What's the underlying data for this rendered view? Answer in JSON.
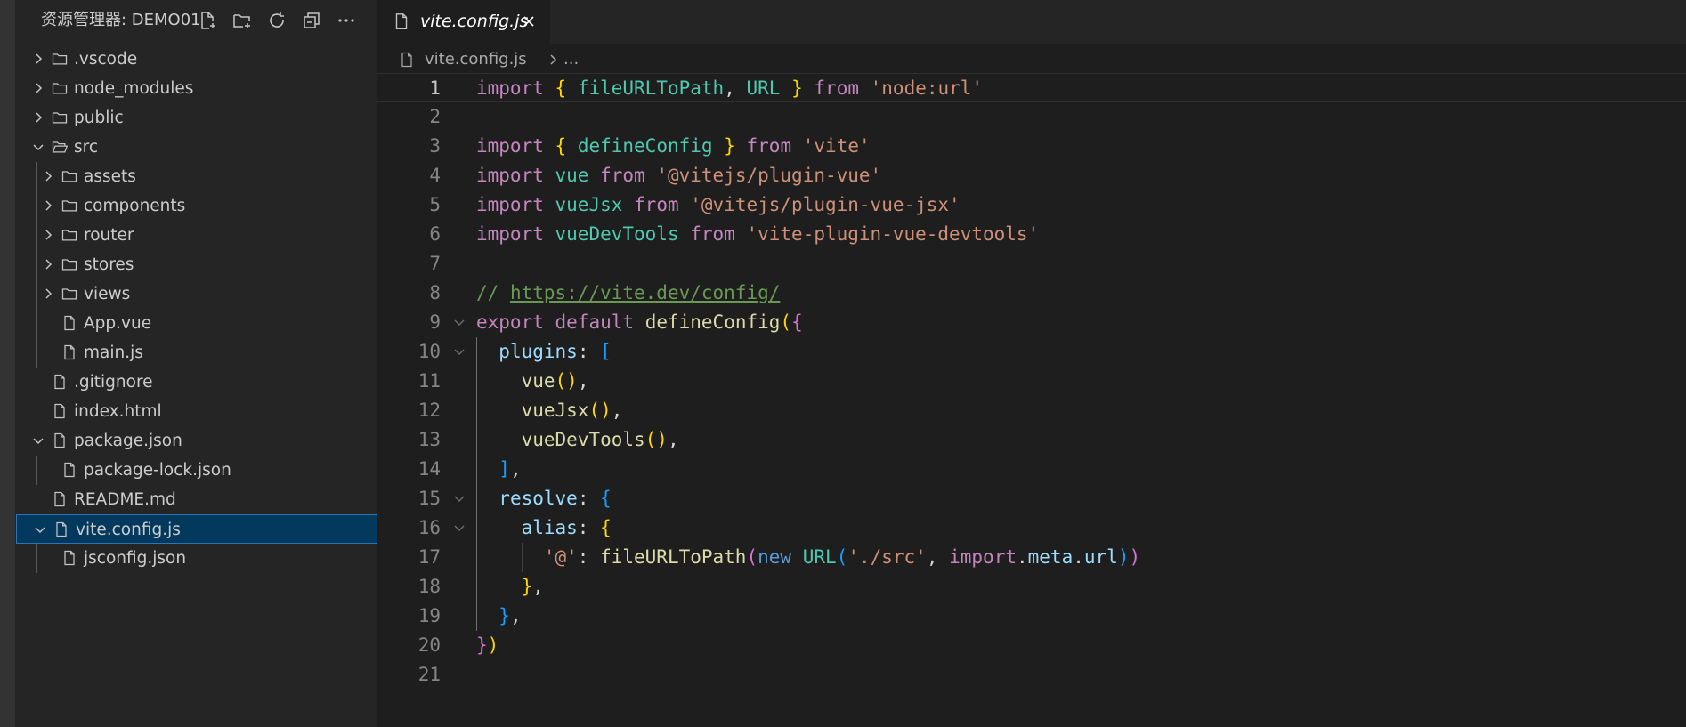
{
  "colors": {
    "sidebar_bg": "#252526",
    "editor_bg": "#1e1e1e",
    "selection_bg": "#04395e",
    "selection_border": "#2c74b8",
    "keyword": "#c586c0",
    "string": "#ce9178",
    "function": "#dcdcaa",
    "comment": "#6a9955"
  },
  "explorer": {
    "title": "资源管理器: DEMO01",
    "actions": [
      {
        "name": "new-file-icon"
      },
      {
        "name": "new-folder-icon"
      },
      {
        "name": "refresh-icon"
      },
      {
        "name": "collapse-all-icon"
      },
      {
        "name": "more-actions-icon"
      }
    ],
    "items": [
      {
        "label": ".vscode",
        "depth": 0,
        "type": "folder",
        "expanded": false,
        "selected": false
      },
      {
        "label": "node_modules",
        "depth": 0,
        "type": "folder",
        "expanded": false,
        "selected": false
      },
      {
        "label": "public",
        "depth": 0,
        "type": "folder",
        "expanded": false,
        "selected": false
      },
      {
        "label": "src",
        "depth": 0,
        "type": "folder",
        "expanded": true,
        "selected": false
      },
      {
        "label": "assets",
        "depth": 1,
        "type": "folder",
        "expanded": false,
        "selected": false
      },
      {
        "label": "components",
        "depth": 1,
        "type": "folder",
        "expanded": false,
        "selected": false
      },
      {
        "label": "router",
        "depth": 1,
        "type": "folder",
        "expanded": false,
        "selected": false
      },
      {
        "label": "stores",
        "depth": 1,
        "type": "folder",
        "expanded": false,
        "selected": false
      },
      {
        "label": "views",
        "depth": 1,
        "type": "folder",
        "expanded": false,
        "selected": false
      },
      {
        "label": "App.vue",
        "depth": 1,
        "type": "file",
        "expanded": false,
        "selected": false
      },
      {
        "label": "main.js",
        "depth": 1,
        "type": "file",
        "expanded": false,
        "selected": false
      },
      {
        "label": ".gitignore",
        "depth": 0,
        "type": "file",
        "expanded": false,
        "selected": false
      },
      {
        "label": "index.html",
        "depth": 0,
        "type": "file",
        "expanded": false,
        "selected": false
      },
      {
        "label": "package.json",
        "depth": 0,
        "type": "nestfile",
        "expanded": true,
        "selected": false
      },
      {
        "label": "package-lock.json",
        "depth": 1,
        "type": "file",
        "expanded": false,
        "selected": false
      },
      {
        "label": "README.md",
        "depth": 0,
        "type": "file",
        "expanded": false,
        "selected": false
      },
      {
        "label": "vite.config.js",
        "depth": 0,
        "type": "nestfile",
        "expanded": true,
        "selected": true
      },
      {
        "label": "jsconfig.json",
        "depth": 1,
        "type": "file",
        "expanded": false,
        "selected": false
      }
    ]
  },
  "editor": {
    "tab": {
      "label": "vite.config.js",
      "close_icon": "close-icon",
      "file_icon": "file-icon"
    },
    "breadcrumb": {
      "file": "vite.config.js",
      "more": "..."
    },
    "active_line": 1,
    "lines": [
      {
        "n": "1",
        "fold": false,
        "indent": 0,
        "tokens": [
          [
            "kw",
            "import"
          ],
          [
            "p",
            " "
          ],
          [
            "b1",
            "{"
          ],
          [
            "p",
            " "
          ],
          [
            "ty",
            "fileURLToPath"
          ],
          [
            "p",
            ", "
          ],
          [
            "ty",
            "URL"
          ],
          [
            "p",
            " "
          ],
          [
            "b1",
            "}"
          ],
          [
            "p",
            " "
          ],
          [
            "kw",
            "from"
          ],
          [
            "p",
            " "
          ],
          [
            "str",
            "'node:url'"
          ]
        ]
      },
      {
        "n": "2",
        "fold": false,
        "indent": 0,
        "tokens": []
      },
      {
        "n": "3",
        "fold": false,
        "indent": 0,
        "tokens": [
          [
            "kw",
            "import"
          ],
          [
            "p",
            " "
          ],
          [
            "b1",
            "{"
          ],
          [
            "p",
            " "
          ],
          [
            "ty",
            "defineConfig"
          ],
          [
            "p",
            " "
          ],
          [
            "b1",
            "}"
          ],
          [
            "p",
            " "
          ],
          [
            "kw",
            "from"
          ],
          [
            "p",
            " "
          ],
          [
            "str",
            "'vite'"
          ]
        ]
      },
      {
        "n": "4",
        "fold": false,
        "indent": 0,
        "tokens": [
          [
            "kw",
            "import"
          ],
          [
            "p",
            " "
          ],
          [
            "ty",
            "vue"
          ],
          [
            "p",
            " "
          ],
          [
            "kw",
            "from"
          ],
          [
            "p",
            " "
          ],
          [
            "str",
            "'@vitejs/plugin-vue'"
          ]
        ]
      },
      {
        "n": "5",
        "fold": false,
        "indent": 0,
        "tokens": [
          [
            "kw",
            "import"
          ],
          [
            "p",
            " "
          ],
          [
            "ty",
            "vueJsx"
          ],
          [
            "p",
            " "
          ],
          [
            "kw",
            "from"
          ],
          [
            "p",
            " "
          ],
          [
            "str",
            "'@vitejs/plugin-vue-jsx'"
          ]
        ]
      },
      {
        "n": "6",
        "fold": false,
        "indent": 0,
        "tokens": [
          [
            "kw",
            "import"
          ],
          [
            "p",
            " "
          ],
          [
            "ty",
            "vueDevTools"
          ],
          [
            "p",
            " "
          ],
          [
            "kw",
            "from"
          ],
          [
            "p",
            " "
          ],
          [
            "str",
            "'vite-plugin-vue-devtools'"
          ]
        ]
      },
      {
        "n": "7",
        "fold": false,
        "indent": 0,
        "tokens": []
      },
      {
        "n": "8",
        "fold": false,
        "indent": 0,
        "tokens": [
          [
            "com",
            "// "
          ],
          [
            "link",
            "https://vite.dev/config/"
          ]
        ]
      },
      {
        "n": "9",
        "fold": true,
        "indent": 0,
        "tokens": [
          [
            "kw",
            "export"
          ],
          [
            "p",
            " "
          ],
          [
            "kw",
            "default"
          ],
          [
            "p",
            " "
          ],
          [
            "fn",
            "defineConfig"
          ],
          [
            "b1",
            "("
          ],
          [
            "b2",
            "{"
          ]
        ]
      },
      {
        "n": "10",
        "fold": true,
        "indent": 1,
        "tokens": [
          [
            "p",
            "  "
          ],
          [
            "var",
            "plugins"
          ],
          [
            "p",
            ": "
          ],
          [
            "b3",
            "["
          ]
        ]
      },
      {
        "n": "11",
        "fold": false,
        "indent": 2,
        "tokens": [
          [
            "p",
            "    "
          ],
          [
            "fn",
            "vue"
          ],
          [
            "b1",
            "()"
          ],
          [
            "p",
            ","
          ]
        ]
      },
      {
        "n": "12",
        "fold": false,
        "indent": 2,
        "tokens": [
          [
            "p",
            "    "
          ],
          [
            "fn",
            "vueJsx"
          ],
          [
            "b1",
            "()"
          ],
          [
            "p",
            ","
          ]
        ]
      },
      {
        "n": "13",
        "fold": false,
        "indent": 2,
        "tokens": [
          [
            "p",
            "    "
          ],
          [
            "fn",
            "vueDevTools"
          ],
          [
            "b1",
            "()"
          ],
          [
            "p",
            ","
          ]
        ]
      },
      {
        "n": "14",
        "fold": false,
        "indent": 1,
        "tokens": [
          [
            "p",
            "  "
          ],
          [
            "b3",
            "]"
          ],
          [
            "p",
            ","
          ]
        ]
      },
      {
        "n": "15",
        "fold": true,
        "indent": 1,
        "tokens": [
          [
            "p",
            "  "
          ],
          [
            "var",
            "resolve"
          ],
          [
            "p",
            ": "
          ],
          [
            "b3",
            "{"
          ]
        ]
      },
      {
        "n": "16",
        "fold": true,
        "indent": 2,
        "tokens": [
          [
            "p",
            "    "
          ],
          [
            "var",
            "alias"
          ],
          [
            "p",
            ": "
          ],
          [
            "b1",
            "{"
          ]
        ]
      },
      {
        "n": "17",
        "fold": false,
        "indent": 3,
        "tokens": [
          [
            "p",
            "      "
          ],
          [
            "str",
            "'@'"
          ],
          [
            "p",
            ": "
          ],
          [
            "fn",
            "fileURLToPath"
          ],
          [
            "b2",
            "("
          ],
          [
            "kw2",
            "new"
          ],
          [
            "p",
            " "
          ],
          [
            "ty",
            "URL"
          ],
          [
            "b3",
            "("
          ],
          [
            "str",
            "'./src'"
          ],
          [
            "p",
            ", "
          ],
          [
            "kw",
            "import"
          ],
          [
            "p",
            "."
          ],
          [
            "var",
            "meta"
          ],
          [
            "p",
            "."
          ],
          [
            "var",
            "url"
          ],
          [
            "b3",
            ")"
          ],
          [
            "b2",
            ")"
          ]
        ]
      },
      {
        "n": "18",
        "fold": false,
        "indent": 2,
        "tokens": [
          [
            "p",
            "    "
          ],
          [
            "b1",
            "}"
          ],
          [
            "p",
            ","
          ]
        ]
      },
      {
        "n": "19",
        "fold": false,
        "indent": 1,
        "tokens": [
          [
            "p",
            "  "
          ],
          [
            "b3",
            "}"
          ],
          [
            "p",
            ","
          ]
        ]
      },
      {
        "n": "20",
        "fold": false,
        "indent": 0,
        "tokens": [
          [
            "b2",
            "}"
          ],
          [
            "b1",
            ")"
          ]
        ]
      },
      {
        "n": "21",
        "fold": false,
        "indent": 0,
        "tokens": []
      }
    ]
  }
}
